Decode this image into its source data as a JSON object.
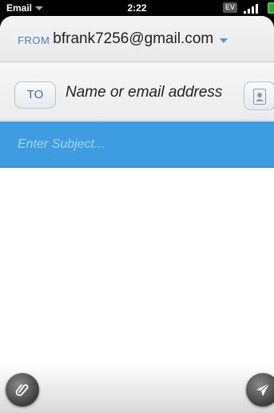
{
  "status_bar": {
    "app_menu_label": "Email",
    "time": "2:22",
    "network": "EV"
  },
  "compose": {
    "from_label": "FROM",
    "from_email": "bfrank7256@gmail.com",
    "to_button_label": "TO",
    "to_placeholder": "Name or email address",
    "subject_placeholder": "Enter Subject...",
    "body_value": ""
  },
  "icons": {
    "app_menu": "chevron-down-icon",
    "signal": "signal-strength-icon",
    "battery": "battery-icon",
    "contact_picker": "contact-card-icon",
    "attach": "paperclip-icon",
    "send": "send-arrow-icon"
  },
  "colors": {
    "subject_bar": "#3e9ce0",
    "accent_blue": "#4a7fb8",
    "battery_green": "#3fce3f"
  }
}
